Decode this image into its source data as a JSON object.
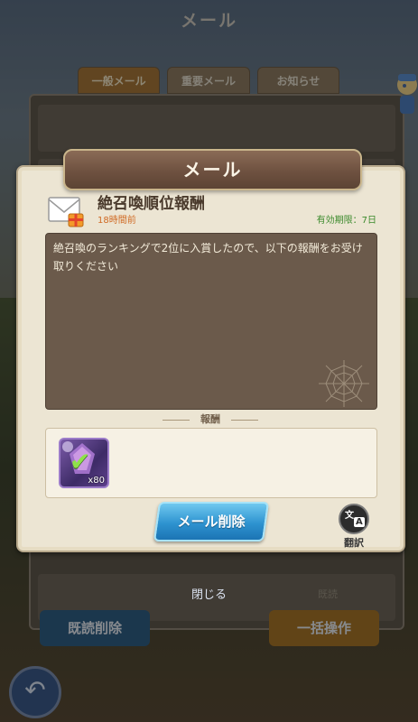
{
  "screen": {
    "title": "メール",
    "tabs": [
      {
        "label": "一般メール",
        "active": true
      },
      {
        "label": "重要メール",
        "active": false
      },
      {
        "label": "お知らせ",
        "active": false
      }
    ],
    "bottom_buttons": {
      "bulk_read_delete": "既読削除",
      "bulk_action": "一括操作"
    },
    "list_read_status": "既読",
    "back_icon": "back-arrow-icon"
  },
  "modal": {
    "title": "メール",
    "subject": "絶召喚順位報酬",
    "time_ago": "18時間前",
    "expiry": "有効期限：7日",
    "body": "絶召喚のランキングで2位に入賞したので、以下の報酬をお受け取りください",
    "reward_label": "報酬",
    "reward_item": {
      "icon": "summon-crystal-icon",
      "count": "x80",
      "claimed": true
    },
    "delete_button": "メール削除",
    "translate_label": "翻訳",
    "translate_glyphs": {
      "top": "文",
      "bottom": "A"
    },
    "close_label": "閉じる"
  },
  "colors": {
    "modal_bg": "#ece5d3",
    "title_bar": "#6e5140",
    "body_box": "#6b5a4b",
    "time_ago": "#d06a24",
    "expiry": "#3b8a2c",
    "delete_button": "#2e93d0"
  }
}
